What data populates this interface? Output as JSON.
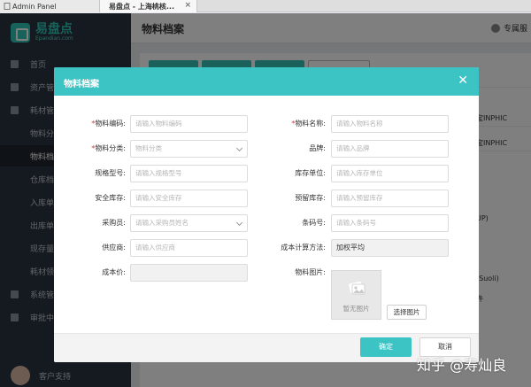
{
  "browser": {
    "tabs": [
      {
        "label": "Admin Panel"
      },
      {
        "label": "易盘点 - 上海桃核..."
      }
    ]
  },
  "app": {
    "logo": {
      "name": "易盘点",
      "sub": "Epandian.com"
    },
    "page_title": "物料档案",
    "header_right": "专属服",
    "sidebar": {
      "items": [
        {
          "label": "首页"
        },
        {
          "label": "资产管"
        },
        {
          "label": "耗材管"
        },
        {
          "label": "物料分"
        },
        {
          "label": "物料档"
        },
        {
          "label": "仓库档"
        },
        {
          "label": "入库单"
        },
        {
          "label": "出库单"
        },
        {
          "label": "现存量"
        },
        {
          "label": "耗材领"
        },
        {
          "label": "系统管"
        },
        {
          "label": "审批中"
        }
      ],
      "support": "客户支持"
    },
    "background_cells": [
      "宝INPHIC",
      "宝INPHIC",
      "UP)",
      "(Suoli)",
      "件"
    ]
  },
  "dialog": {
    "title": "物料档案",
    "close_icon": "close-icon",
    "fields": {
      "code": {
        "label": "物料编码:",
        "required": true,
        "placeholder": "请输入物料编码"
      },
      "name": {
        "label": "物料名称:",
        "required": true,
        "placeholder": "请输入物料名称"
      },
      "category": {
        "label": "物料分类:",
        "required": true,
        "placeholder": "物料分类"
      },
      "brand": {
        "label": "品牌:",
        "placeholder": "请输入品牌"
      },
      "spec": {
        "label": "规格型号:",
        "placeholder": "请输入规格型号"
      },
      "unit": {
        "label": "库存单位:",
        "placeholder": "请输入库存单位"
      },
      "safety_stock": {
        "label": "安全库存:",
        "placeholder": "请输入安全库存"
      },
      "warn_stock": {
        "label": "预留库存:",
        "placeholder": "请输入预留库存"
      },
      "buyer": {
        "label": "采购员:",
        "placeholder": "请输入采购员姓名"
      },
      "barcode": {
        "label": "条码号:",
        "placeholder": "请输入条码号"
      },
      "supplier": {
        "label": "供应商:",
        "placeholder": "请输入供应商"
      },
      "cost_method": {
        "label": "成本计算方法:",
        "value": "加权平均"
      },
      "cost_price": {
        "label": "成本价:",
        "value": ""
      },
      "image": {
        "label": "物料图片:",
        "empty_text": "暂无图片",
        "choose": "选择图片"
      }
    },
    "buttons": {
      "ok": "确定",
      "cancel": "取消"
    }
  },
  "watermark": "知乎 @寿灿良",
  "colors": {
    "accent": "#3cc4c4",
    "sidebar": "#2a3440",
    "required": "#d9363e"
  }
}
